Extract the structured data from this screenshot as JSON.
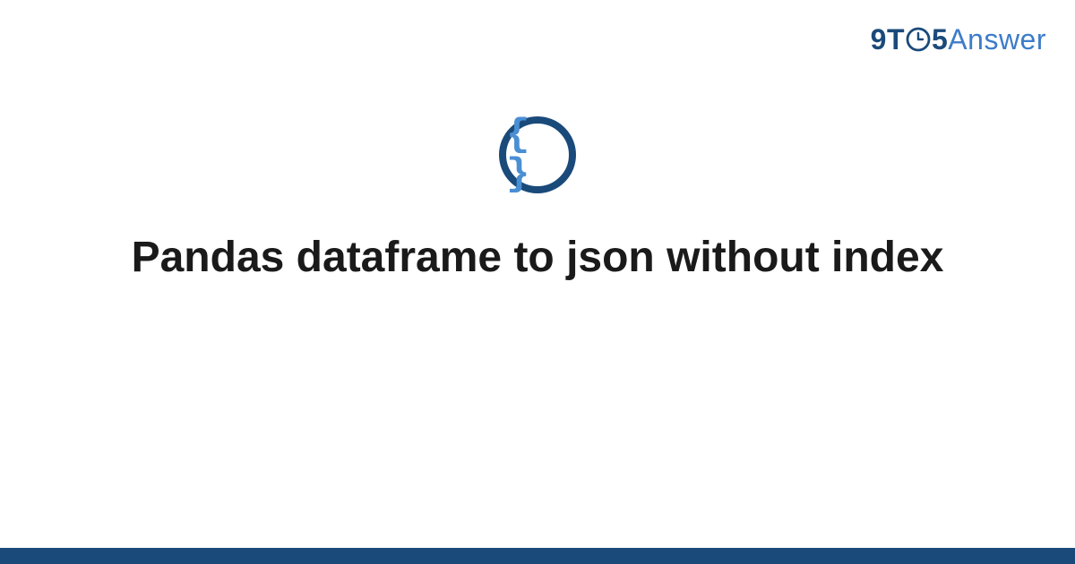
{
  "logo": {
    "part1": "9",
    "part2": "T",
    "part3": "5",
    "part4": "Answer"
  },
  "icon": {
    "name": "braces-icon",
    "glyph": "{ }"
  },
  "title": "Pandas dataframe to json without index",
  "colors": {
    "brand_dark": "#1a4a7a",
    "brand_light": "#3d7cc9",
    "brace_blue": "#4a8fd4",
    "text": "#1a1a1a"
  }
}
